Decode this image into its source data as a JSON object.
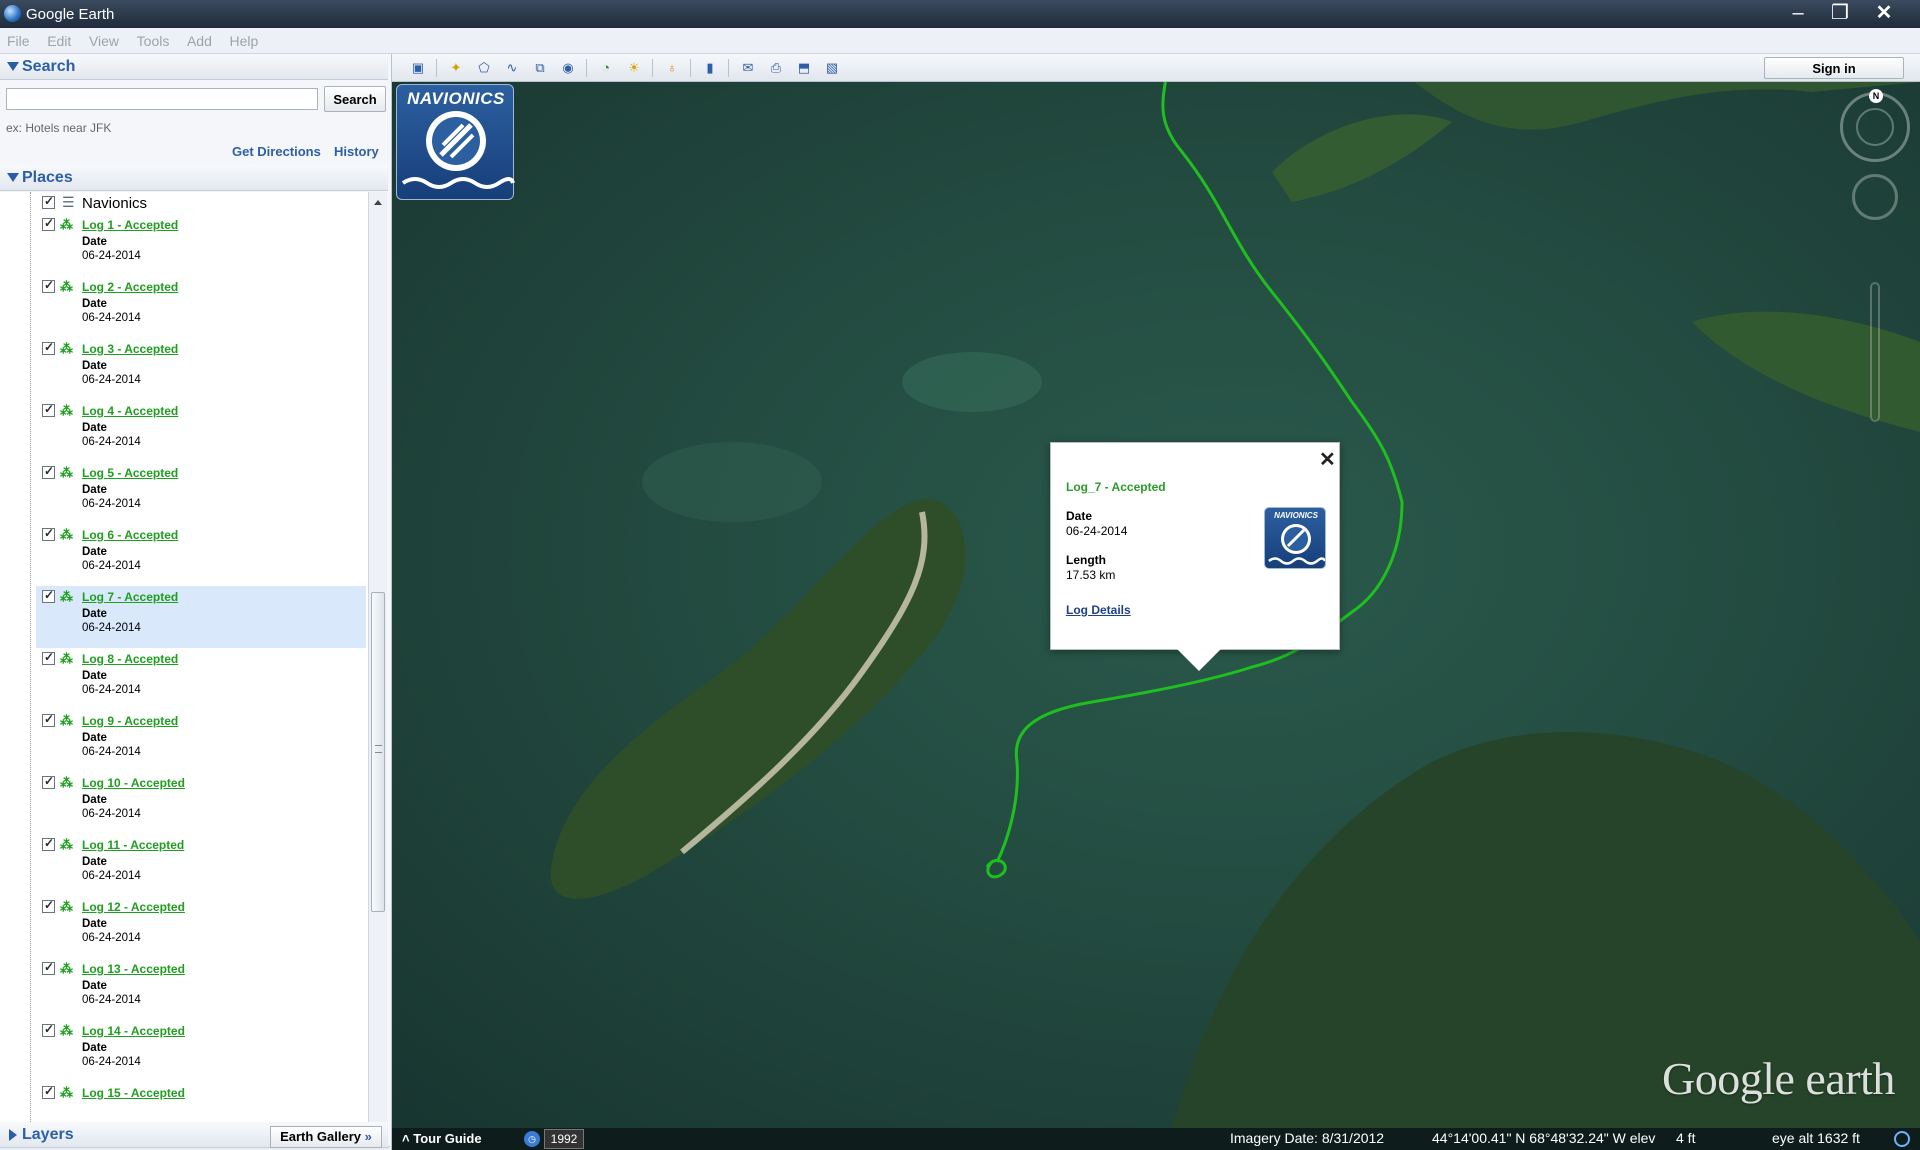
{
  "window": {
    "title": "Google Earth"
  },
  "menu": [
    "File",
    "Edit",
    "View",
    "Tools",
    "Add",
    "Help"
  ],
  "search": {
    "header": "Search",
    "placeholder": "",
    "button": "Search",
    "hint": "ex: Hotels near JFK",
    "get_directions": "Get Directions",
    "history": "History"
  },
  "places": {
    "header": "Places",
    "root": "Navionics",
    "date_label": "Date",
    "items": [
      {
        "title": "Log 1 - Accepted",
        "date": "06-24-2014"
      },
      {
        "title": "Log 2 - Accepted",
        "date": "06-24-2014"
      },
      {
        "title": "Log 3 - Accepted",
        "date": "06-24-2014"
      },
      {
        "title": "Log 4 - Accepted",
        "date": "06-24-2014"
      },
      {
        "title": "Log 5 - Accepted",
        "date": "06-24-2014"
      },
      {
        "title": "Log 6 - Accepted",
        "date": "06-24-2014"
      },
      {
        "title": "Log 7 - Accepted",
        "date": "06-24-2014"
      },
      {
        "title": "Log 8 - Accepted",
        "date": "06-24-2014"
      },
      {
        "title": "Log 9 - Accepted",
        "date": "06-24-2014"
      },
      {
        "title": "Log 10 - Accepted",
        "date": "06-24-2014"
      },
      {
        "title": "Log 11 - Accepted",
        "date": "06-24-2014"
      },
      {
        "title": "Log 12 - Accepted",
        "date": "06-24-2014"
      },
      {
        "title": "Log 13 - Accepted",
        "date": "06-24-2014"
      },
      {
        "title": "Log 14 - Accepted",
        "date": "06-24-2014"
      },
      {
        "title": "Log 15 - Accepted",
        "date": ""
      }
    ]
  },
  "layers": {
    "header": "Layers",
    "gallery_button": "Earth Gallery",
    "gallery_chevron": "»"
  },
  "toolbar": {
    "sign_in": "Sign in"
  },
  "map": {
    "logo_text": "NAVIONICS",
    "compass_north": "N",
    "watermark": "Google earth"
  },
  "balloon": {
    "title": "Log_7 - Accepted",
    "date_label": "Date",
    "date": "06-24-2014",
    "length_label": "Length",
    "length": "17.53 km",
    "log_details": "Log Details",
    "logo_text": "NAVIONICS",
    "close": "✕"
  },
  "status": {
    "tour_guide": "Tour Guide",
    "year": "1992",
    "imagery_date": "Imagery Date: 8/31/2012",
    "coordinates": "44°14'00.41\" N   68°48'32.24\" W  elev",
    "elevation": "4 ft",
    "eye_alt": "eye alt   1632 ft"
  },
  "colors": {
    "track": "#1fbf1f",
    "link_green": "#1f9f1f",
    "header_blue": "#2d5ea8"
  }
}
